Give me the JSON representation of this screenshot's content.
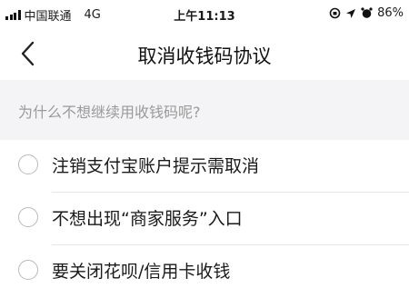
{
  "status_bar": {
    "carrier": "中国联通",
    "network": "4G",
    "time": "上午11:13",
    "battery": "86%"
  },
  "nav": {
    "title": "取消收钱码协议"
  },
  "question": "为什么不想继续用收钱码呢?",
  "options": [
    {
      "label": "注销支付宝账户提示需取消"
    },
    {
      "label": "不想出现“商家服务”入口"
    },
    {
      "label": "要关闭花呗/信用卡收钱"
    }
  ]
}
